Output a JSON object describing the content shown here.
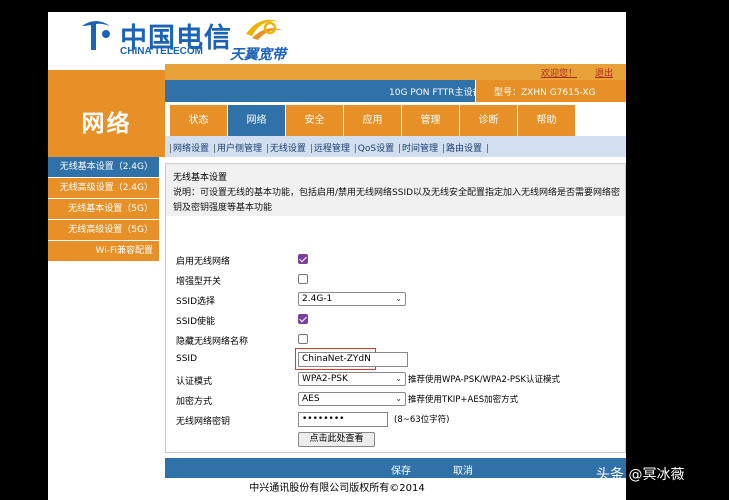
{
  "header": {
    "brand_cn": "中国电信",
    "brand_en": "CHINA TELECOM",
    "sub_brand": "天翼宽带"
  },
  "topbar": {
    "welcome": "欢迎您！",
    "logout": "退出",
    "product": "10G PON FTTR主设备",
    "model": "型号：ZXHN G7615-XG"
  },
  "section_title": "网络",
  "nav": {
    "tabs": [
      {
        "label": "状态",
        "active": false
      },
      {
        "label": "网络",
        "active": true
      },
      {
        "label": "安全",
        "active": false
      },
      {
        "label": "应用",
        "active": false
      },
      {
        "label": "管理",
        "active": false
      },
      {
        "label": "诊断",
        "active": false
      },
      {
        "label": "帮助",
        "active": false
      }
    ]
  },
  "subnav": {
    "items": [
      "网络设置",
      "用户侧管理",
      "无线设置",
      "远程管理",
      "QoS设置",
      "时间管理",
      "路由设置"
    ]
  },
  "sidebar": {
    "items": [
      {
        "label": "无线基本设置（2.4G）",
        "active": true
      },
      {
        "label": "无线高级设置（2.4G）",
        "active": false
      },
      {
        "label": "无线基本设置（5G）",
        "active": false
      },
      {
        "label": "无线高级设置（5G）",
        "active": false
      },
      {
        "label": "Wi-Fi兼容配置",
        "active": false
      }
    ]
  },
  "content": {
    "title": "无线基本设置",
    "description": "说明：可设置无线的基本功能，包括启用/禁用无线网络SSID以及无线安全配置指定加入无线网络是否需要网络密钥及密钥强度等基本功能",
    "fields": {
      "enable_wireless": {
        "label": "启用无线网络",
        "checked": true
      },
      "enhanced": {
        "label": "增强型开关",
        "checked": false
      },
      "ssid_select": {
        "label": "SSID选择",
        "value": "2.4G-1"
      },
      "ssid_enable": {
        "label": "SSID使能",
        "checked": true
      },
      "hide_ssid": {
        "label": "隐藏无线网络名称",
        "checked": false
      },
      "ssid": {
        "label": "SSID",
        "value": "ChinaNet-ZYdN"
      },
      "auth_mode": {
        "label": "认证模式",
        "value": "WPA2-PSK",
        "hint": "推荐使用WPA-PSK/WPA2-PSK认证模式"
      },
      "encryption": {
        "label": "加密方式",
        "value": "AES",
        "hint": "推荐使用TKIP+AES加密方式"
      },
      "key": {
        "label": "无线网络密钥",
        "value": "••••••••",
        "hint": "(8~63位字符)"
      },
      "view_button": "点击此处查看"
    }
  },
  "footer": {
    "save": "保存",
    "cancel": "取消",
    "copyright": "中兴通讯股份有限公司版权所有©2014"
  },
  "watermark": "头条 @冥冰薇",
  "colors": {
    "orange": "#e69027",
    "blue": "#2f71a8",
    "brand_blue": "#1c63b6",
    "highlight_red": "#d63a2a"
  }
}
